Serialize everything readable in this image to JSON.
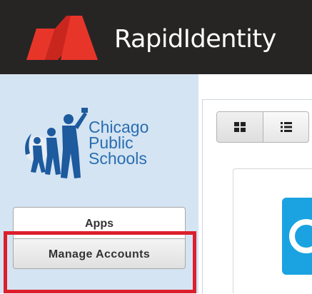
{
  "header": {
    "app_title": "RapidIdentity",
    "logo_icon": "rapididentity-logo-icon",
    "brand_color": "#e8352a"
  },
  "sidebar": {
    "org_logo": {
      "icon": "chicago-public-schools-logo",
      "line1": "Chicago",
      "line2": "Public",
      "line3": "Schools",
      "color": "#2a6db1"
    },
    "nav": [
      {
        "label": "Apps"
      },
      {
        "label": "Manage Accounts"
      }
    ],
    "highlight_color": "#dc1f2d"
  },
  "main": {
    "view_toggle": {
      "grid_icon": "grid-view-icon",
      "list_icon": "list-view-icon"
    },
    "app_tile_icon": "app-tile-icon",
    "tile_color": "#1aa3e0"
  }
}
